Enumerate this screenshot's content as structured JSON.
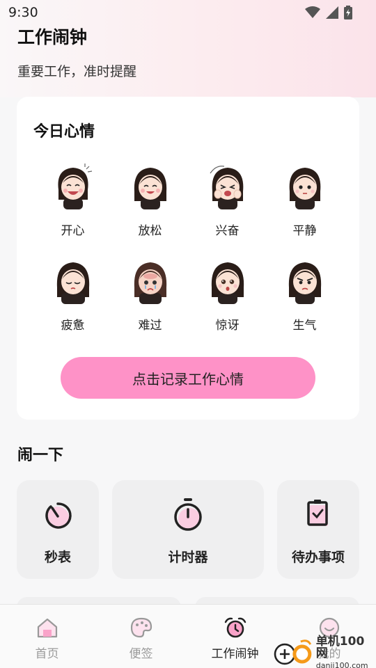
{
  "status_bar": {
    "time": "9:30"
  },
  "header": {
    "title": "工作闹钟",
    "subtitle": "重要工作，准时提醒"
  },
  "mood_card": {
    "title": "今日心情",
    "moods": [
      {
        "label": "开心",
        "icon": "happy-face-icon"
      },
      {
        "label": "放松",
        "icon": "relaxed-face-icon"
      },
      {
        "label": "兴奋",
        "icon": "excited-face-icon"
      },
      {
        "label": "平静",
        "icon": "calm-face-icon"
      },
      {
        "label": "疲惫",
        "icon": "tired-face-icon"
      },
      {
        "label": "难过",
        "icon": "sad-face-icon"
      },
      {
        "label": "惊讶",
        "icon": "surprised-face-icon"
      },
      {
        "label": "生气",
        "icon": "angry-face-icon"
      }
    ],
    "record_button": "点击记录工作心情"
  },
  "tools_section": {
    "title": "闹一下",
    "tools": [
      {
        "label": "秒表",
        "icon": "stopwatch-icon"
      },
      {
        "label": "计时器",
        "icon": "timer-icon"
      },
      {
        "label": "待办事项",
        "icon": "todo-clipboard-icon"
      }
    ]
  },
  "bottom_nav": {
    "items": [
      {
        "label": "首页",
        "icon": "home-icon",
        "active": false
      },
      {
        "label": "便签",
        "icon": "palette-icon",
        "active": false
      },
      {
        "label": "工作闹钟",
        "icon": "alarm-clock-icon",
        "active": true
      },
      {
        "label": "我的",
        "icon": "profile-icon",
        "active": false
      }
    ]
  },
  "watermark": {
    "main": "单机100网",
    "sub": "danji100.com"
  },
  "colors": {
    "accent_pink": "#fe92c7",
    "card_bg": "#ffffff",
    "tool_bg": "#efeff0"
  }
}
